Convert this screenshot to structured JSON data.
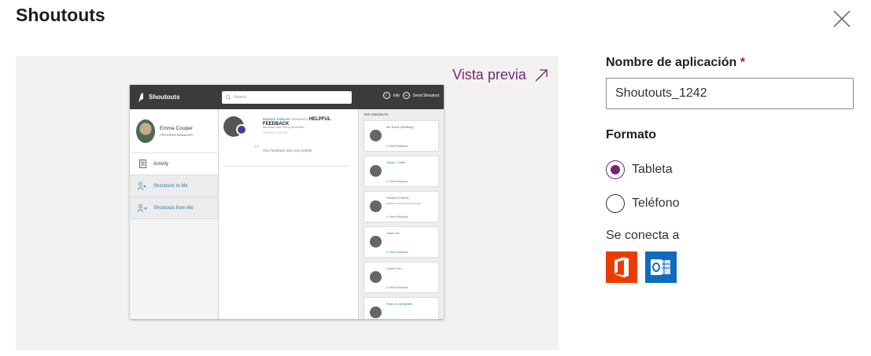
{
  "dialog": {
    "title": "Shoutouts"
  },
  "preview": {
    "link_label": "Vista previa",
    "app": {
      "name": "Shoutouts",
      "search_placeholder": "Search",
      "info_label": "Info",
      "send_label": "Send Shoutout",
      "user_name": "Emma Cooper",
      "user_role": "PROGRAM MANAGER",
      "nav": [
        {
          "label": "Activity"
        },
        {
          "label": "Shoutouts to Me"
        },
        {
          "label": "Shoutouts from Me"
        }
      ],
      "feed": {
        "sender": "Barbara Sankovic",
        "verb": "received a",
        "type": "HELPFUL FEEDBACK",
        "from_line": "shoutout from Percy Bowman",
        "timestamp": "11/13/2017 5:17 PM",
        "message": "Your feedback was very helpful"
      },
      "contacts_header": "TOP CONTACTS",
      "contact_action": "Send Shoutout",
      "contacts": [
        {
          "name": "Ian Davis (Building)",
          "role": ""
        },
        {
          "name": "Hilpert, Callie",
          "role": ""
        },
        {
          "name": "Shekhar Pareek",
          "role": "SENIOR PROGRAM MANAGER"
        },
        {
          "name": "Justin Su",
          "role": ""
        },
        {
          "name": "Calvin Dev",
          "role": ""
        },
        {
          "name": "Ryan Cunningham",
          "role": ""
        }
      ]
    }
  },
  "form": {
    "app_name_label": "Nombre de aplicación",
    "required_mark": "*",
    "app_name_value": "Shoutouts_1242",
    "format_label": "Formato",
    "format_options": [
      {
        "label": "Tableta",
        "selected": true
      },
      {
        "label": "Teléfono",
        "selected": false
      }
    ],
    "connects_label": "Se conecta a",
    "connectors": [
      {
        "icon": "office-icon",
        "color": "#eb3c00"
      },
      {
        "icon": "outlook-icon",
        "color": "#0f6cbd"
      }
    ]
  },
  "colors": {
    "accent": "#742774",
    "preview_bg": "#f3f2f1"
  }
}
